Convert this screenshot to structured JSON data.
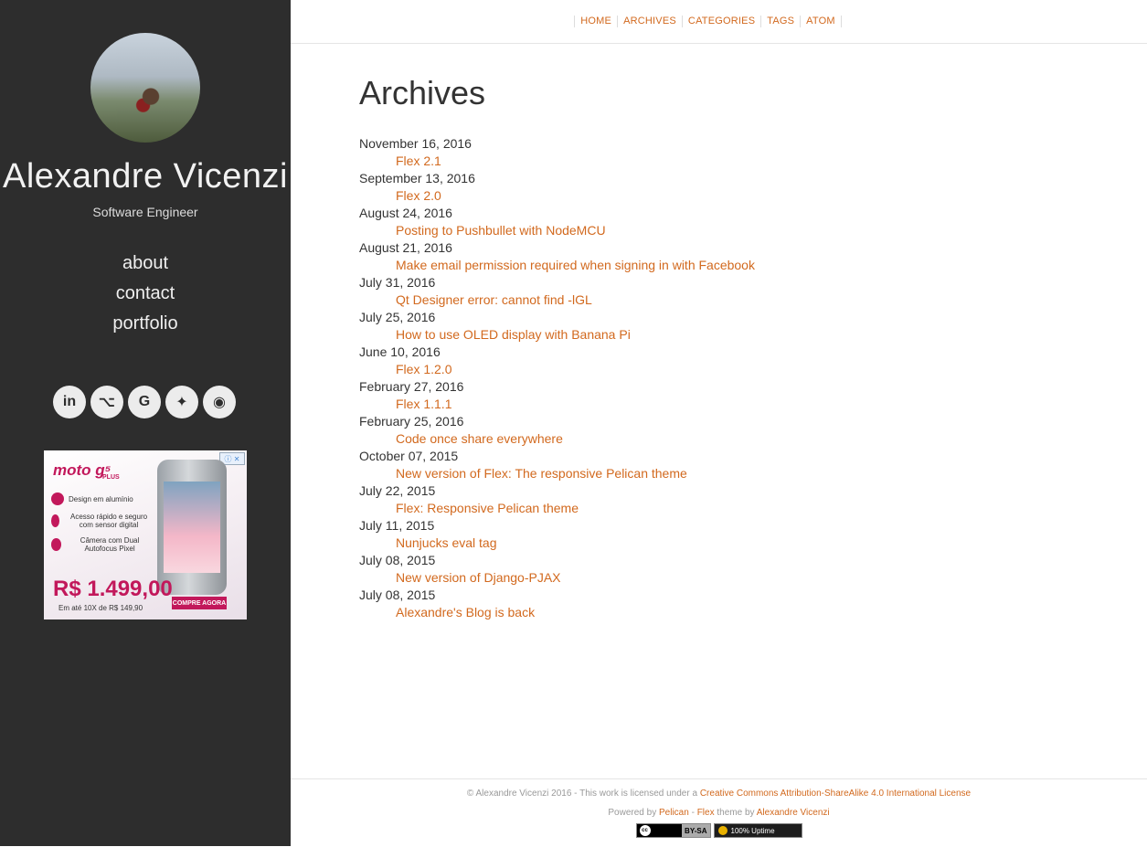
{
  "sidebar": {
    "site_name": "Alexandre Vicenzi",
    "subtitle": "Software Engineer",
    "links": [
      "about",
      "contact",
      "portfolio"
    ],
    "social": [
      {
        "icon": "linkedin-icon",
        "glyph": "in"
      },
      {
        "icon": "github-icon",
        "glyph": "⌥"
      },
      {
        "icon": "google-icon",
        "glyph": "G"
      },
      {
        "icon": "twitter-icon",
        "glyph": "✦"
      },
      {
        "icon": "rss-icon",
        "glyph": "◉"
      }
    ],
    "ad": {
      "brand": "moto g⁵",
      "plus": "PLUS",
      "features": [
        "Design em alumínio",
        "Acesso rápido e seguro com sensor digital",
        "Câmera com Dual Autofocus Pixel"
      ],
      "price": "R$ 1.499,00",
      "installments": "Em até 10X de R$ 149,90",
      "cta": "COMPRE AGORA",
      "adchoice": "ⓘ ✕"
    }
  },
  "nav": {
    "items": [
      "HOME",
      "ARCHIVES",
      "CATEGORIES",
      "TAGS",
      "ATOM"
    ]
  },
  "main": {
    "title": "Archives",
    "entries": [
      {
        "date": "November 16, 2016",
        "title": "Flex 2.1"
      },
      {
        "date": "September 13, 2016",
        "title": "Flex 2.0"
      },
      {
        "date": "August 24, 2016",
        "title": "Posting to Pushbullet with NodeMCU"
      },
      {
        "date": "August 21, 2016",
        "title": "Make email permission required when signing in with Facebook"
      },
      {
        "date": "July 31, 2016",
        "title": "Qt Designer error: cannot find -lGL"
      },
      {
        "date": "July 25, 2016",
        "title": "How to use OLED display with Banana Pi"
      },
      {
        "date": "June 10, 2016",
        "title": "Flex 1.2.0"
      },
      {
        "date": "February 27, 2016",
        "title": "Flex 1.1.1"
      },
      {
        "date": "February 25, 2016",
        "title": "Code once share everywhere"
      },
      {
        "date": "October 07, 2015",
        "title": "New version of Flex: The responsive Pelican theme"
      },
      {
        "date": "July 22, 2015",
        "title": "Flex: Responsive Pelican theme"
      },
      {
        "date": "July 11, 2015",
        "title": "Nunjucks eval tag"
      },
      {
        "date": "July 08, 2015",
        "title": "New version of Django-PJAX"
      },
      {
        "date": "July 08, 2015",
        "title": "Alexandre's Blog is back"
      }
    ]
  },
  "footer": {
    "copyright": "© Alexandre Vicenzi 2016 - This work is licensed under a ",
    "license_link": "Creative Commons Attribution-ShareAlike 4.0 International License",
    "powered_by": "Powered by ",
    "pelican": "Pelican",
    "sep": " - ",
    "flex": "Flex",
    "theme_by": " theme by ",
    "author": "Alexandre Vicenzi",
    "badge_cc": "BY-SA",
    "badge_cc_icon": "cc",
    "badge_uptime": "100% Uptime"
  },
  "colors": {
    "sidebar_bg": "#2d2d2d",
    "link": "#d2691e"
  }
}
